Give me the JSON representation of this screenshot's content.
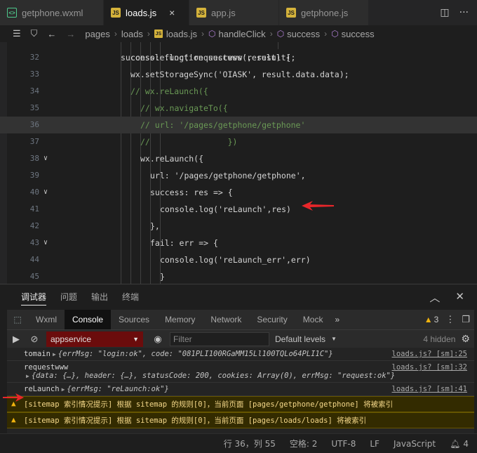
{
  "tabs": [
    {
      "label": "getphone.wxml",
      "type": "wxml",
      "active": false
    },
    {
      "label": "loads.js",
      "type": "js",
      "active": true,
      "close": "×"
    },
    {
      "label": "app.js",
      "type": "js",
      "active": false
    },
    {
      "label": "getphone.js",
      "type": "js",
      "active": false
    }
  ],
  "breadcrumb": {
    "items": [
      "pages",
      "loads",
      "loads.js",
      "handleClick",
      "success",
      "success"
    ]
  },
  "editor": {
    "ghost_line": "success: function success(result) {",
    "lines": [
      {
        "num": "32",
        "indent": 0,
        "code": "console.log('requestwww', result);"
      },
      {
        "num": "33",
        "indent": 0,
        "code": "wx.setStorageSync('OIASK', result.data.data);"
      },
      {
        "num": "34",
        "indent": 1,
        "code": "// wx.reLaunch({"
      },
      {
        "num": "35",
        "indent": 2,
        "code": "// wx.navigateTo({"
      },
      {
        "num": "36",
        "indent": 2,
        "code": "// url: '/pages/getphone/getphone'"
      },
      {
        "num": "37",
        "indent": 2,
        "code": "//                })"
      },
      {
        "num": "38",
        "indent": 2,
        "code": "wx.reLaunch({"
      },
      {
        "num": "39",
        "indent": 3,
        "code": "url: '/pages/getphone/getphone',"
      },
      {
        "num": "40",
        "indent": 3,
        "code": "success: res => {"
      },
      {
        "num": "41",
        "indent": 4,
        "code": "console.log('reLaunch',res)"
      },
      {
        "num": "42",
        "indent": 3,
        "code": "},"
      },
      {
        "num": "43",
        "indent": 3,
        "code": "fail: err => {"
      },
      {
        "num": "44",
        "indent": 4,
        "code": "console.log('reLaunch_err',err)"
      },
      {
        "num": "45",
        "indent": 4,
        "code": "}"
      }
    ]
  },
  "panel": {
    "tabs": [
      "调试器",
      "问题",
      "输出",
      "终端"
    ],
    "devtools_tabs": [
      "Wxml",
      "Console",
      "Sources",
      "Memory",
      "Network",
      "Security",
      "Mock"
    ],
    "more": "»",
    "warning_count": "3",
    "context": "appservice",
    "filter_placeholder": "Filter",
    "levels": "Default levels",
    "hidden": "4 hidden"
  },
  "console": {
    "logs": [
      {
        "label": "tomain",
        "detail": "{errMsg: \"login:ok\", code: \"081PLI100RGaMM15Ll100TQLo64PLI1C\"}",
        "src": "loads.js? [sm]:25"
      },
      {
        "label": "requestwww",
        "detail": "{data: {…}, header: {…}, statusCode: 200, cookies: Array(0), errMsg: \"request:ok\"}",
        "src": "loads.js? [sm]:32"
      },
      {
        "label": "reLaunch",
        "detail": "{errMsg: \"reLaunch:ok\"}",
        "src": "loads.js? [sm]:41"
      }
    ],
    "warnings": [
      "[sitemap 索引情况提示] 根据 sitemap 的规则[0]，当前页面 [pages/getphone/getphone] 将被索引",
      "[sitemap 索引情况提示] 根据 sitemap 的规则[0]，当前页面 [pages/loads/loads] 将被索引"
    ]
  },
  "statusbar": {
    "position": "行 36，列 55",
    "spaces": "空格: 2",
    "encoding": "UTF-8",
    "eol": "LF",
    "language": "JavaScript",
    "notifications": "4"
  },
  "colors": {
    "annotation_arrow": "#e8262a",
    "context_bg": "#6b0c0c",
    "warning_bg": "#332b00"
  }
}
